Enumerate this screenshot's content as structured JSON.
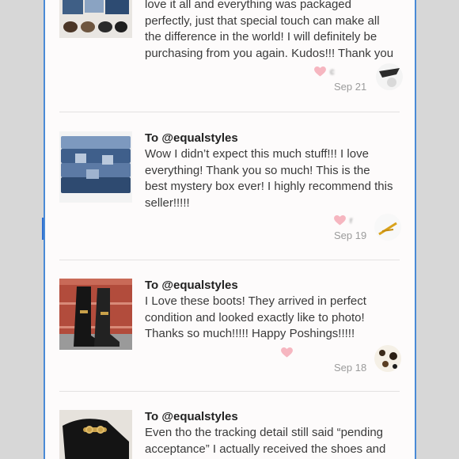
{
  "reviews": [
    {
      "to": "",
      "text": "love it all and everything was packaged\nperfectly, just that special touch can make all\nthe difference in the world! I will definitely be\npurchasing from you again. Kudos!!! Thank you",
      "user": "c",
      "date": "Sep 21",
      "thumb_icon": "clothes-and-shoes-photo"
    },
    {
      "to": "To @equalstyles",
      "text": "Wow I didn’t expect this much stuff!!! I love\neverything! Thank you so much! This is the\nbest mystery box ever! I highly recommend this\nseller!!!!!",
      "user": "r",
      "date": "Sep 19",
      "thumb_icon": "jeans-stack-photo"
    },
    {
      "to": "To @equalstyles",
      "text": "I Love these boots! They arrived in perfect\ncondition and looked exactly like to photo!\nThanks so much!!!!! Happy Poshings!!!!!",
      "user": "",
      "date": "Sep 18",
      "thumb_icon": "black-boots-photo"
    },
    {
      "to": "To @equalstyles",
      "text": "Even tho the tracking detail still said “pending\nacceptance” I actually received the shoes and",
      "user": "",
      "date": "",
      "thumb_icon": "black-loafers-photo"
    }
  ],
  "colors": {
    "heart": "#f6b6c0",
    "divider": "#e4e2e2",
    "scroll_marker": "#2f6fd0"
  }
}
